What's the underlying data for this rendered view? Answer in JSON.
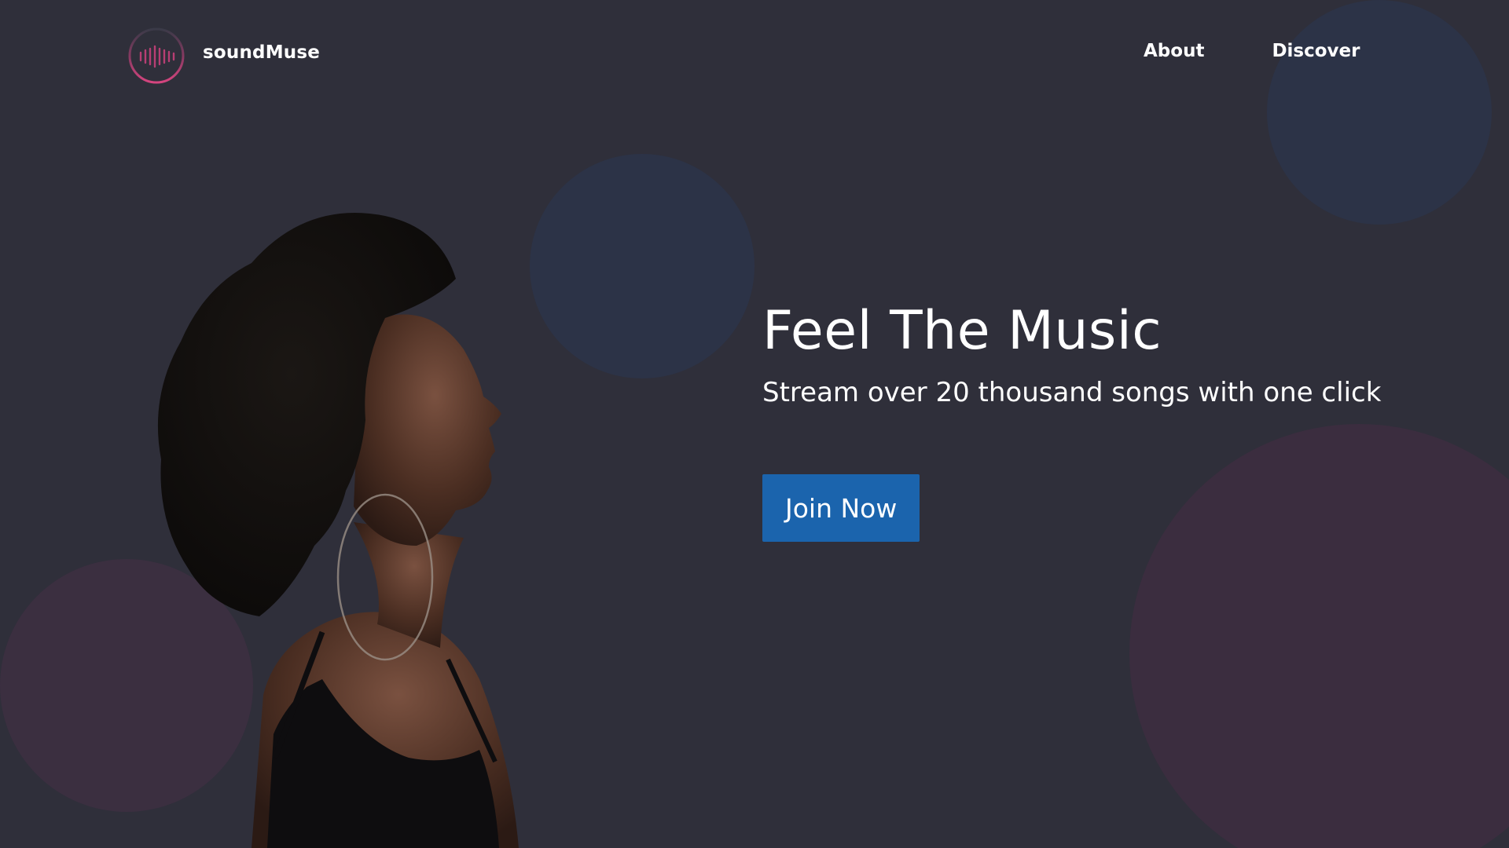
{
  "brand": {
    "name": "soundMuse",
    "logo_icon": "soundwave-circle-icon",
    "accent_color": "#c2437a"
  },
  "nav": {
    "items": [
      {
        "label": "About"
      },
      {
        "label": "Discover"
      }
    ]
  },
  "hero": {
    "title": "Feel The Music",
    "subtitle": "Stream over 20 thousand songs with one click",
    "cta_label": "Join Now",
    "cta_color": "#1b64ad",
    "image": "woman-listening-profile"
  },
  "colors": {
    "background": "#2f2f3a",
    "circle_blue": "#2c3347",
    "circle_mauve": "#3b2d3f"
  }
}
